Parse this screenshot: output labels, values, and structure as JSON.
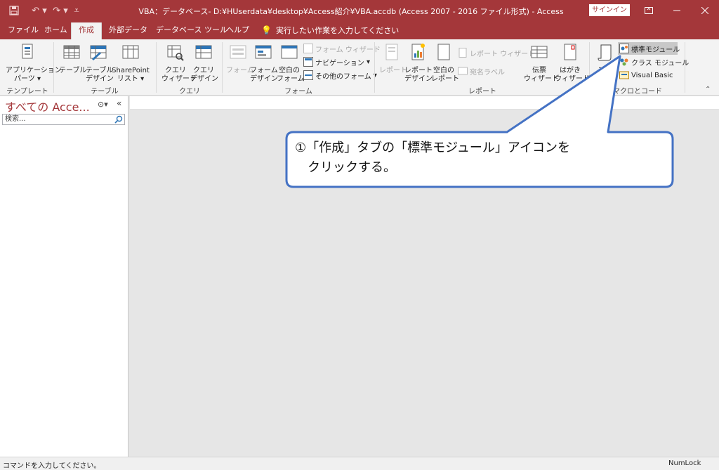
{
  "titlebar": {
    "title": "VBA：データベース- D:¥HUserdata¥desktop¥Access紹介¥VBA.accdb (Access 2007 - 2016 ファイル形式) - Access",
    "signin": "サインイン",
    "icons": [
      "save-icon",
      "undo-icon",
      "redo-icon",
      "customize-icon",
      "minimize-icon",
      "maximize-icon",
      "close-icon"
    ]
  },
  "tabs": [
    {
      "label": "ファイル"
    },
    {
      "label": "ホーム"
    },
    {
      "label": "作成"
    },
    {
      "label": "外部データ"
    },
    {
      "label": "データベース ツール"
    },
    {
      "label": "ヘルプ"
    }
  ],
  "tellme": "実行したい作業を入力してください",
  "ribbon": {
    "templates": {
      "label": "テンプレート",
      "app_parts": "アプリケーション",
      "app_parts2": "パーツ"
    },
    "tables": {
      "label": "テーブル",
      "table": "テーブル",
      "table_design1": "テーブル",
      "table_design2": "デザイン",
      "sharepoint1": "SharePoint",
      "sharepoint2": "リスト"
    },
    "queries": {
      "label": "クエリ",
      "wizard1": "クエリ",
      "wizard2": "ウィザード",
      "design1": "クエリ",
      "design2": "デザイン"
    },
    "forms": {
      "label": "フォーム",
      "form": "フォーム",
      "form_design1": "フォーム",
      "form_design2": "デザイン",
      "blank1": "空白の",
      "blank2": "フォーム",
      "form_wizard": "フォーム ウィザード",
      "navigation": "ナビゲーション",
      "more": "その他のフォーム"
    },
    "reports": {
      "label": "レポート",
      "report": "レポート",
      "report_design1": "レポート",
      "report_design2": "デザイン",
      "blank1": "空白の",
      "blank2": "レポート",
      "report_wizard": "レポート ウィザード",
      "labels": "宛名ラベル",
      "slip1": "伝票",
      "slip2": "ウィザード",
      "postcard1": "はがき",
      "postcard2": "ウィザード"
    },
    "macros": {
      "label": "マクロとコード",
      "macro": "マク",
      "module": "標準モジュール",
      "class_module": "クラス モジュール",
      "vb": "Visual Basic"
    }
  },
  "nav": {
    "title": "すべての Acce...",
    "search_placeholder": "検索..."
  },
  "callout": {
    "line1": "①「作成」タブの「標準モジュール」アイコンを",
    "line2": "　クリックする。"
  },
  "status": {
    "text": "コマンドを入力してください。",
    "numlock": "NumLock"
  },
  "colors": {
    "accent": "#a4373a",
    "callout_border": "#4472c4"
  }
}
